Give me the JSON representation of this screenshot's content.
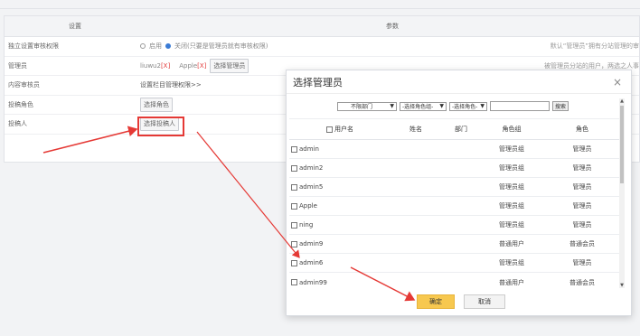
{
  "settings": {
    "col_setting": "设置",
    "col_params": "参数",
    "rows": [
      {
        "label": "独立设置审核权限",
        "opt_on": "启用",
        "opt_off": "关闭(只要是管理员就有审核权限)",
        "note": "默认“管理员”拥有分站管理的审"
      },
      {
        "label": "管理员",
        "user1": "liuwu2",
        "user2": "Apple",
        "remove": "[X]",
        "button": "选择管理员",
        "note": "被管理员分站的用户，两选之人事"
      },
      {
        "label": "内容审核员",
        "link": "设置栏目管理权限>>"
      },
      {
        "label": "投稿角色",
        "button": "选择角色"
      },
      {
        "label": "投稿人",
        "button": "选择投稿人"
      }
    ]
  },
  "dialog": {
    "title": "选择管理员",
    "close": "×",
    "filters": {
      "dept": "不限部门",
      "role_group": "-选择角色组-",
      "role": "-选择角色-",
      "keyword": "",
      "search": "搜索"
    },
    "columns": {
      "username": "用户名",
      "name": "姓名",
      "dept": "部门",
      "group": "角色组",
      "role": "角色"
    },
    "rows": [
      {
        "username": "admin",
        "name": "",
        "dept": "",
        "group": "管理员组",
        "role": "管理员"
      },
      {
        "username": "admin2",
        "name": "",
        "dept": "",
        "group": "管理员组",
        "role": "管理员"
      },
      {
        "username": "admin5",
        "name": "",
        "dept": "",
        "group": "管理员组",
        "role": "管理员"
      },
      {
        "username": "Apple",
        "name": "",
        "dept": "",
        "group": "管理员组",
        "role": "管理员"
      },
      {
        "username": "ning",
        "name": "",
        "dept": "",
        "group": "管理员组",
        "role": "管理员"
      },
      {
        "username": "admin9",
        "name": "",
        "dept": "",
        "group": "普通用户",
        "role": "普通会员"
      },
      {
        "username": "admin6",
        "name": "",
        "dept": "",
        "group": "管理员组",
        "role": "管理员"
      },
      {
        "username": "admin99",
        "name": "",
        "dept": "",
        "group": "普通用户",
        "role": "普通会员"
      }
    ],
    "ok": "确定",
    "cancel": "取消"
  },
  "colors": {
    "accent": "#f7c84f",
    "annotation": "#e53935",
    "radio_checked": "#3a7bd5"
  },
  "icons": {
    "close": "close-icon",
    "select_arrow": "chevron-down-icon",
    "scroll_up": "scroll-up-icon",
    "scroll_down": "scroll-down-icon"
  }
}
